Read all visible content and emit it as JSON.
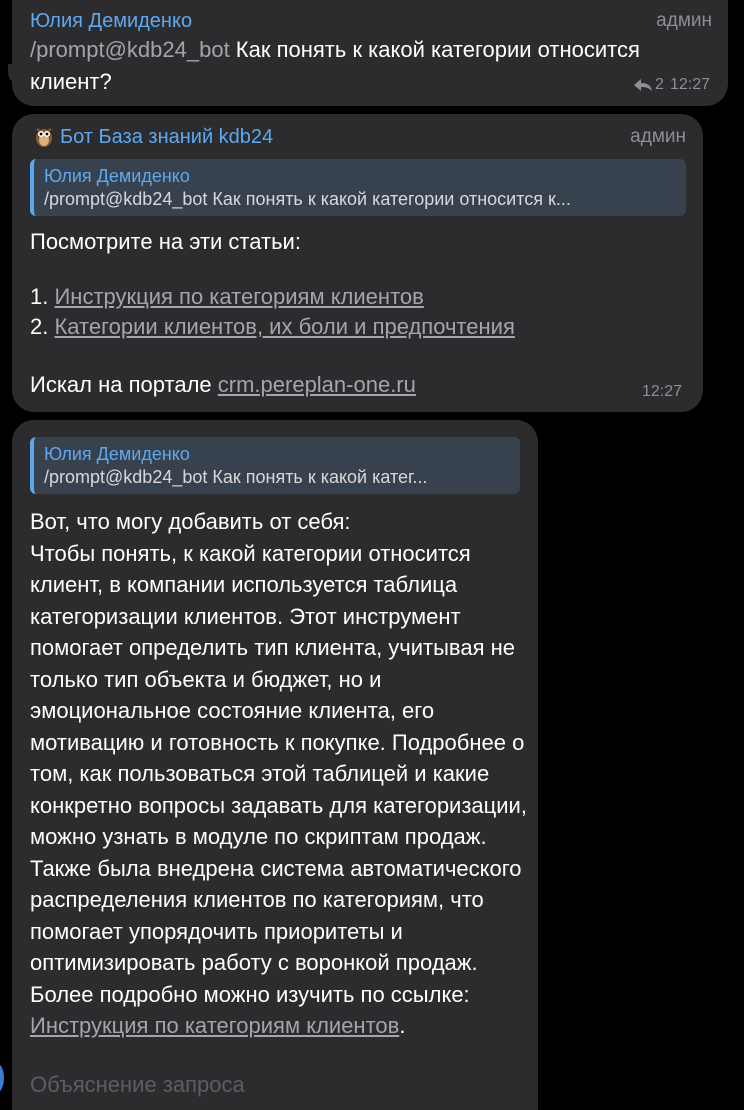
{
  "messages": [
    {
      "sender": "Юлия Демиденко",
      "role": "админ",
      "command": "/prompt@kdb24_bot",
      "text": " Как понять к какой категории относится клиент?",
      "replies_count": "2",
      "time": "12:27"
    },
    {
      "sender": "Бот База знаний kdb24",
      "role": "админ",
      "quote_name": "Юлия Демиденко",
      "quote_text": "/prompt@kdb24_bot Как понять к какой категории относится к...",
      "intro": "Посмотрите на эти статьи:",
      "items": [
        {
          "num": "1.",
          "link": "Инструкция по категориям клиентов"
        },
        {
          "num": "2.",
          "link": "Категории клиентов, их боли и предпочтения"
        }
      ],
      "source_label": "Искал на портале",
      "source_link": "crm.pereplan-one.ru",
      "time": "12:27"
    },
    {
      "quote_name": "Юлия Демиденко",
      "quote_text": "/prompt@kdb24_bot Как понять к какой катег...",
      "body": "Вот, что могу добавить от себя:\nЧтобы понять, к какой категории относится клиент, в компании используется таблица категоризации клиентов. Этот инструмент помогает определить тип клиента, учитывая не только тип объекта и бюджет, но и эмоциональное состояние клиента, его мотивацию и готовность к покупке. Подробнее о том, как пользоваться этой таблицей и какие конкретно вопросы задавать для категоризации, можно узнать в модуле по скриптам продаж. Также была внедрена система автоматического распределения клиентов по категориям, что помогает упорядочить приоритеты и оптимизировать работу с воронкой продаж. Более подробно можно изучить по ссылке:",
      "link": "Инструкция по категориям клиентов",
      "after_link": ".",
      "next_line": "Объяснение запроса"
    }
  ]
}
